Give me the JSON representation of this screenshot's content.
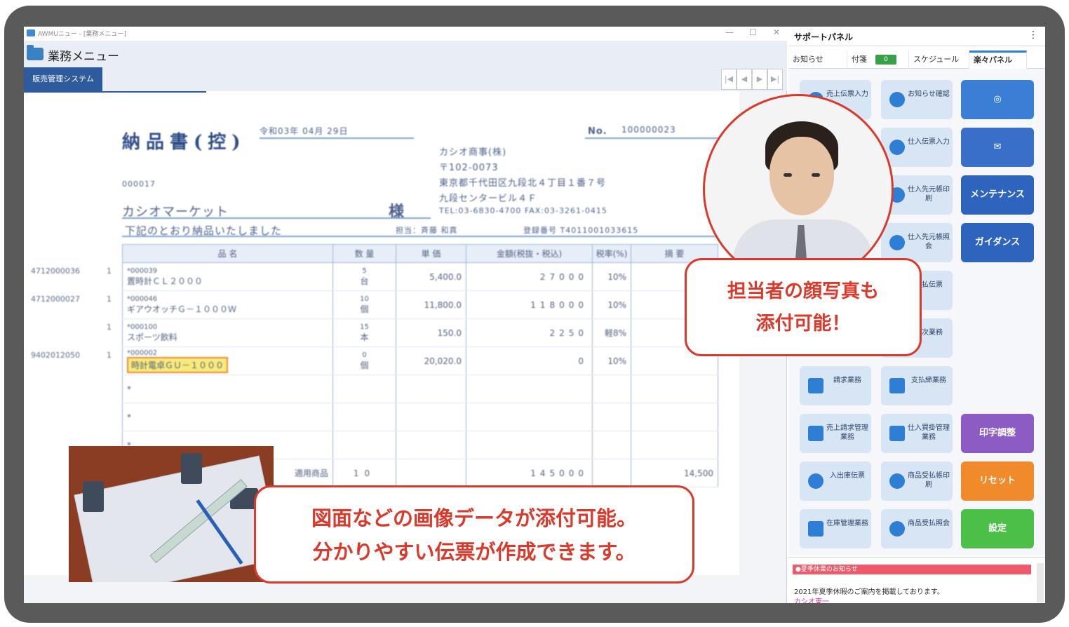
{
  "window": {
    "title": "AWMUニュー - [業務メニュー]",
    "app_name": "業務メニュー",
    "tab": "販売管理システム",
    "controls": [
      "—",
      "☐",
      "✕"
    ],
    "nav": [
      "|◀",
      "◀",
      "▶",
      "▶|"
    ]
  },
  "slip": {
    "title": "納品書(控)",
    "date": "令和03年 04月 29日",
    "no_label": "No.",
    "no_value": "100000023",
    "company": [
      "カシオ商事(株)",
      "〒102-0073",
      "東京都千代田区九段北４丁目１番７号",
      "九段センタービル４Ｆ",
      "TEL:03-6830-4700    FAX:03-3261-0415"
    ],
    "customer_code": "000017",
    "customer_name": "カシオマーケット",
    "honorific": "様",
    "message": "下記のとおり納品いたしました",
    "staff": "担当：斉藤 和真",
    "reg_no": "登録番号 T4011001033615",
    "headers": [
      "品 名",
      "数 量",
      "単 価",
      "金額(税抜・税込)",
      "税率(%)",
      "摘 要"
    ],
    "rows": [
      {
        "code": "*000039",
        "name": "置時計ＣＬ２０００",
        "qty": "5",
        "unit": "台",
        "price": "5,400.0",
        "amount": "27000",
        "tax": "10%"
      },
      {
        "code": "*000046",
        "name": "ギアウオッチＧ－１０００Ｗ",
        "qty": "10",
        "unit": "個",
        "price": "11,800.0",
        "amount": "118000",
        "tax": "10%"
      },
      {
        "code": "*000100",
        "name": "スポーツ飲料",
        "qty": "15",
        "unit": "本",
        "price": "150.0",
        "amount": "2250",
        "tax": "軽8%"
      },
      {
        "code": "*000002",
        "name": "時計電卓ＧＵ－１０００",
        "qty": "0",
        "unit": "個",
        "price": "20,020.0",
        "amount": "0",
        "tax": "10%"
      }
    ],
    "side_codes": [
      "4712000036",
      "4712000027",
      "9402012050"
    ],
    "total_label": "適用商品",
    "total_qty": "10",
    "total_amount": "145000",
    "total_right": "14,500"
  },
  "callouts": {
    "attach_line1": "図面などの画像データが添付可能。",
    "attach_line2": "分かりやすい伝票が作成できます。",
    "face_line1": "担当者の顔写真も",
    "face_line2": "添付可能！"
  },
  "panel": {
    "title": "サポートパネル",
    "more": "⋮",
    "tabs": [
      "お知らせ",
      "付箋",
      "スケジュール",
      "楽々パネル"
    ],
    "badge": "0",
    "tiles": [
      {
        "label": "売上伝票入力"
      },
      {
        "label": "お知らせ確認"
      },
      {
        "label": "仕入伝票入力"
      },
      {
        "label": "仕入先元帳印刷"
      },
      {
        "label": "仕入先元帳照会"
      },
      {
        "label": "支払伝票"
      },
      {
        "label": "日次業務"
      },
      {
        "label": "請求業務"
      },
      {
        "label": "支払締業務"
      },
      {
        "label": "売上請求管理業務"
      },
      {
        "label": "仕入買掛管理業務"
      },
      {
        "label": "入出庫伝票"
      },
      {
        "label": "商品受払帳印刷"
      },
      {
        "label": "在庫管理業務"
      },
      {
        "label": "商品受払照会"
      }
    ],
    "buttons": [
      {
        "label": "web-icon",
        "color": "#3a7fd5"
      },
      {
        "label": "mail-icon",
        "color": "#3a6fc9"
      },
      {
        "label": "メンテナンス",
        "color": "#2e63be"
      },
      {
        "label": "ガイダンス",
        "color": "#2e63be"
      },
      {
        "label": "印字調整",
        "color": "#8c5bc4"
      },
      {
        "label": "リセット",
        "color": "#f08a2a"
      },
      {
        "label": "設定",
        "color": "#4cbf48"
      }
    ],
    "notice_header": "●夏季休業のお知らせ",
    "notice_text": "2021年夏季休暇のご案内を掲載しております。",
    "notice_author": "カシオ東一"
  }
}
